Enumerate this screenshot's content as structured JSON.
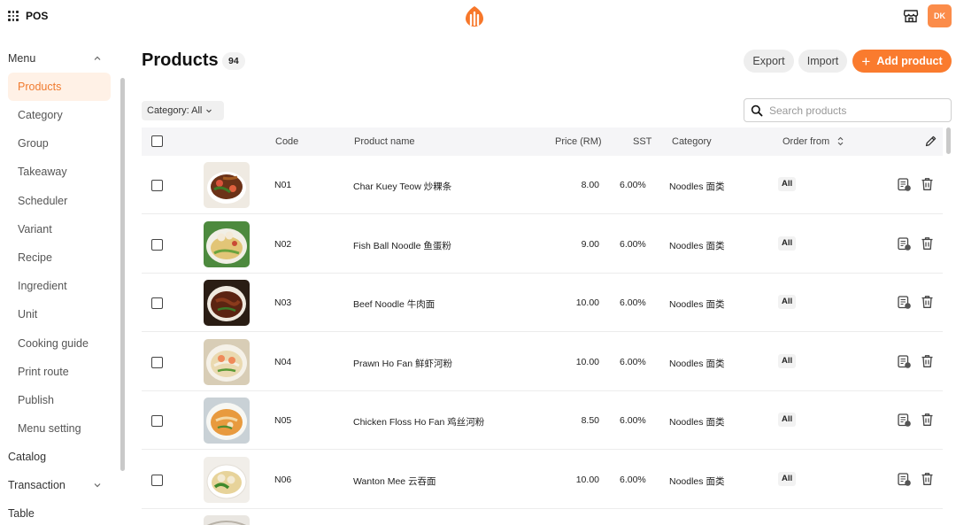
{
  "app": {
    "name": "POS",
    "avatar_initials": "DK",
    "accent": "#fa7b2e"
  },
  "sidebar": {
    "menu_label": "Menu",
    "items": [
      {
        "label": "Products",
        "active": true
      },
      {
        "label": "Category"
      },
      {
        "label": "Group"
      },
      {
        "label": "Takeaway"
      },
      {
        "label": "Scheduler"
      },
      {
        "label": "Variant"
      },
      {
        "label": "Recipe"
      },
      {
        "label": "Ingredient"
      },
      {
        "label": "Unit"
      },
      {
        "label": "Cooking guide"
      },
      {
        "label": "Print route"
      },
      {
        "label": "Publish"
      },
      {
        "label": "Menu setting"
      }
    ],
    "catalog_label": "Catalog",
    "transaction_label": "Transaction",
    "table_label": "Table"
  },
  "header": {
    "title": "Products",
    "count": "94",
    "export_label": "Export",
    "import_label": "Import",
    "add_label": "Add product"
  },
  "filter": {
    "label": "Category: All"
  },
  "search": {
    "placeholder": "Search products"
  },
  "table": {
    "columns": {
      "code": "Code",
      "name": "Product name",
      "price": "Price (RM)",
      "sst": "SST",
      "category": "Category",
      "order_from": "Order from"
    },
    "rows": [
      {
        "code": "N01",
        "name": "Char Kuey Teow 炒粿条",
        "price": "8.00",
        "sst": "6.00%",
        "category": "Noodles 面类",
        "order_from": "All"
      },
      {
        "code": "N02",
        "name": "Fish Ball Noodle 鱼蛋粉",
        "price": "9.00",
        "sst": "6.00%",
        "category": "Noodles 面类",
        "order_from": "All"
      },
      {
        "code": "N03",
        "name": "Beef Noodle 牛肉面",
        "price": "10.00",
        "sst": "6.00%",
        "category": "Noodles 面类",
        "order_from": "All"
      },
      {
        "code": "N04",
        "name": "Prawn Ho Fan 鲜虾河粉",
        "price": "10.00",
        "sst": "6.00%",
        "category": "Noodles 面类",
        "order_from": "All"
      },
      {
        "code": "N05",
        "name": "Chicken Floss Ho Fan 鸡丝河粉",
        "price": "8.50",
        "sst": "6.00%",
        "category": "Noodles 面类",
        "order_from": "All"
      },
      {
        "code": "N06",
        "name": "Wanton Mee 云吞面",
        "price": "10.00",
        "sst": "6.00%",
        "category": "Noodles 面类",
        "order_from": "All"
      }
    ]
  }
}
